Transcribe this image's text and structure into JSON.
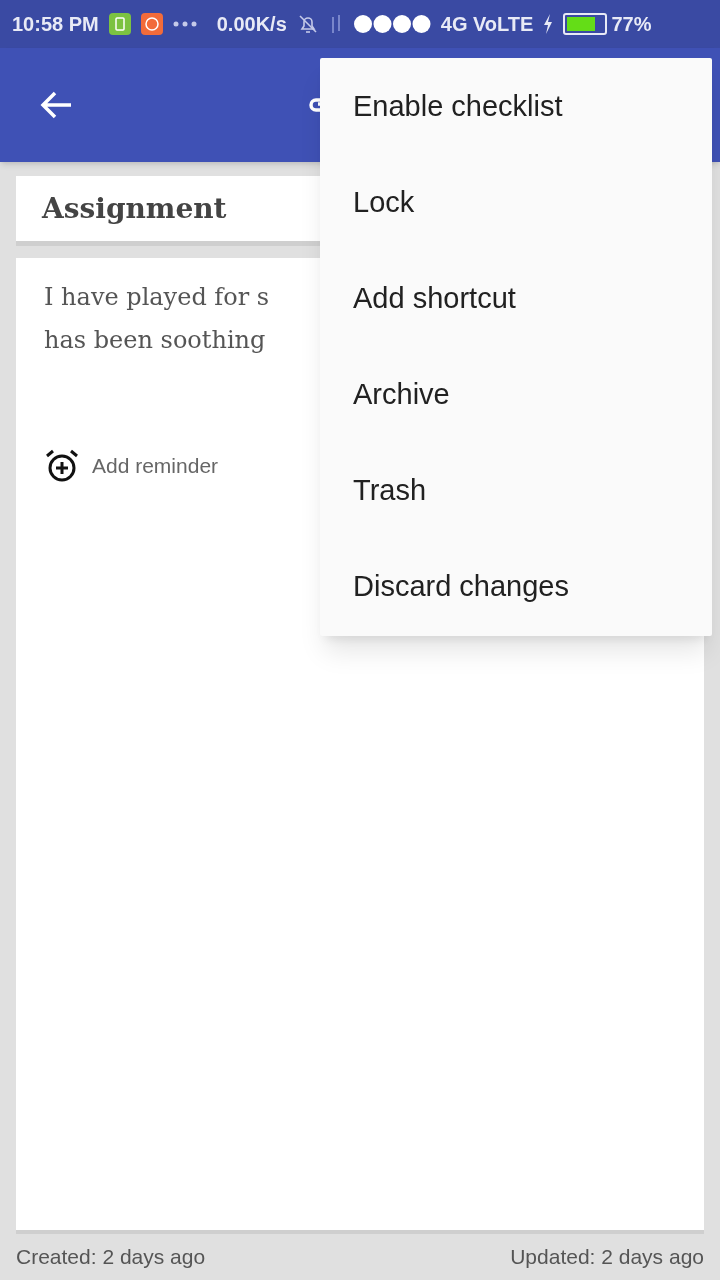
{
  "status_bar": {
    "time": "10:58 PM",
    "speed": "0.00K/s",
    "network": "4G VoLTE",
    "battery": "77%"
  },
  "note": {
    "title": "Assignment",
    "body_lines": [
      "I have played for s",
      "has been soothing"
    ],
    "reminder": "Add reminder"
  },
  "menu": [
    {
      "label": "Enable checklist"
    },
    {
      "label": "Lock"
    },
    {
      "label": "Add shortcut"
    },
    {
      "label": "Archive"
    },
    {
      "label": "Trash"
    },
    {
      "label": "Discard changes"
    }
  ],
  "footer": {
    "created": "Created: 2 days ago",
    "updated": "Updated: 2 days ago"
  }
}
